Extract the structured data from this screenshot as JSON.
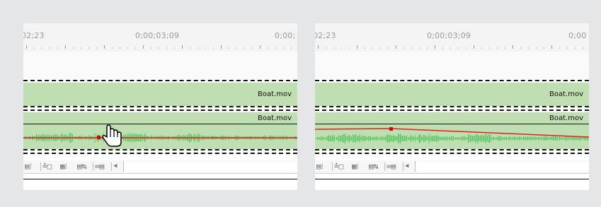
{
  "panels": [
    {
      "id": "left",
      "timecodes": [
        "02;23",
        "0;00;03;09",
        "0;00;"
      ],
      "clip_upper_label": "Boat.mov",
      "clip_lower_label": "Boat.mov",
      "state": "cursor dragging keyframe"
    },
    {
      "id": "right",
      "timecodes": [
        "02;23",
        "0;00;03;09",
        "0;00"
      ],
      "clip_upper_label": "Boat.mov",
      "clip_lower_label": "Boat.mov",
      "state": "keyframe raised, volume ramps down"
    }
  ],
  "icons": [
    "track-display-icon",
    "set-display-style-icon",
    "collapse-expand-icon",
    "keyframe-icon",
    "zoom-icon",
    "scroll-left-arrow-icon",
    "hand-cursor-icon"
  ],
  "colors": {
    "background": "#e5e6e7",
    "clip_fill": "#bfdfb3",
    "waveform": "#4cc15a",
    "volume_line": "#e02020",
    "keyframe": "#e00000"
  }
}
